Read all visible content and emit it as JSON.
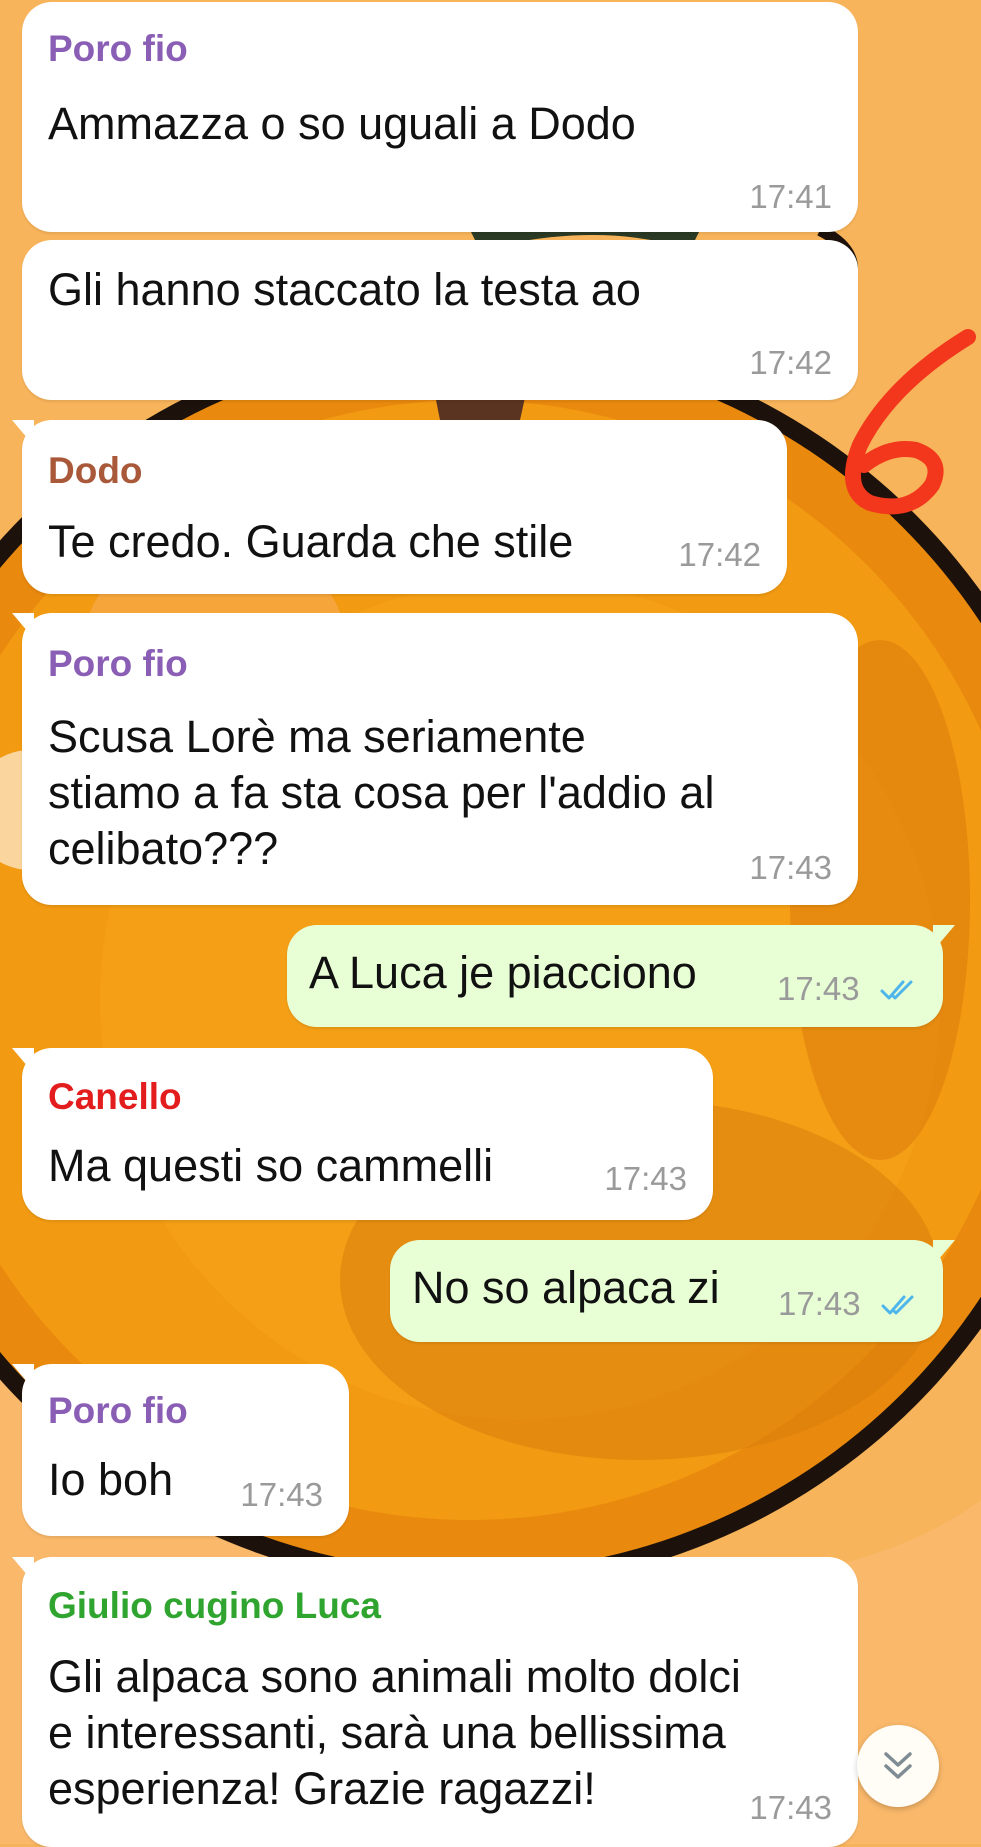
{
  "colors": {
    "wallpaper_light": "#f7b359",
    "wallpaper_orange": "#f29713",
    "incoming_bubble": "#ffffff",
    "outgoing_bubble": "#e8ffd6",
    "timestamp": "#9a9a9a",
    "read_ticks": "#4fb6ec",
    "annotation_red": "#f2371c"
  },
  "annotation": {
    "icon": "handwritten-number-mark"
  },
  "messages": [
    {
      "direction": "incoming",
      "sender": "Poro fio",
      "sender_color": "#8a5eb5",
      "text": "Ammazza o so uguali a Dodo",
      "time": "17:41"
    },
    {
      "direction": "incoming",
      "sender": "",
      "text": "Gli hanno staccato la testa ao",
      "time": "17:42"
    },
    {
      "direction": "incoming",
      "sender": "Dodo",
      "sender_color": "#a9593a",
      "text": "Te credo. Guarda che stile",
      "time": "17:42"
    },
    {
      "direction": "incoming",
      "sender": "Poro fio",
      "sender_color": "#8a5eb5",
      "text": "Scusa Lorè ma seriamente\nstiamo a fa sta cosa per l'addio al\ncelibato???",
      "time": "17:43"
    },
    {
      "direction": "outgoing",
      "text": "A Luca je piacciono",
      "time": "17:43",
      "status_icon": "double-check-read-icon"
    },
    {
      "direction": "incoming",
      "sender": "Canello",
      "sender_color": "#e31d1d",
      "text": "Ma questi so cammelli",
      "time": "17:43"
    },
    {
      "direction": "outgoing",
      "text": "No so alpaca zi",
      "time": "17:43",
      "status_icon": "double-check-read-icon"
    },
    {
      "direction": "incoming",
      "sender": "Poro fio",
      "sender_color": "#8a5eb5",
      "text": "Io boh",
      "time": "17:43"
    },
    {
      "direction": "incoming",
      "sender": "Giulio cugino Luca",
      "sender_color": "#2fa52f",
      "text": "Gli alpaca sono animali molto dolci\ne interessanti, sarà una bellissima\nesperienza! Grazie ragazzi!",
      "time": "17:43"
    }
  ],
  "scroll_button": {
    "icon": "double-chevron-down-icon"
  }
}
